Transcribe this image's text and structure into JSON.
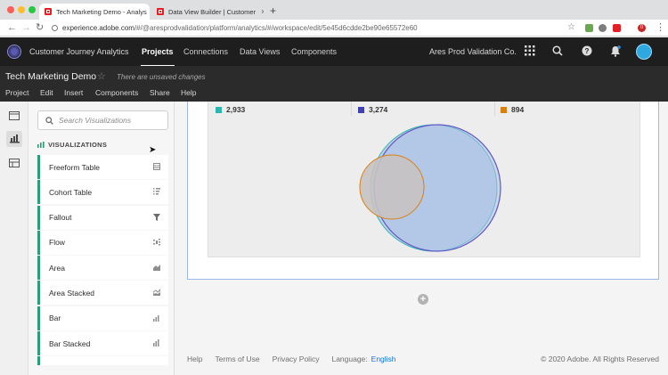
{
  "browser": {
    "tabs": [
      {
        "title": "Tech Marketing Demo - Analys",
        "active": true
      },
      {
        "title": "Data View Builder | Customer",
        "active": false
      }
    ],
    "url_host": "experience.adobe.com",
    "url_path": "/#/@aresprodvalidation/platform/analytics/#/workspace/edit/5e45d6cdde2be90e65572e60",
    "extension_badge": "0"
  },
  "app": {
    "name": "Customer Journey Analytics",
    "nav": [
      {
        "label": "Projects",
        "active": true
      },
      {
        "label": "Connections",
        "active": false
      },
      {
        "label": "Data Views",
        "active": false
      },
      {
        "label": "Components",
        "active": false
      }
    ],
    "org": "Ares Prod Validation Co."
  },
  "project": {
    "title": "Tech Marketing Demo",
    "unsaved": "There are unsaved changes",
    "menu": [
      "Project",
      "Edit",
      "Insert",
      "Components",
      "Share",
      "Help"
    ]
  },
  "visualizations": {
    "search_placeholder": "Search Visualizations",
    "section_title": "VISUALIZATIONS",
    "items": [
      "Freeform Table",
      "Cohort Table",
      "Fallout",
      "Flow",
      "Area",
      "Area Stacked",
      "Bar",
      "Bar Stacked"
    ]
  },
  "chart_data": {
    "type": "venn",
    "series": [
      {
        "name": "",
        "value": 2933,
        "label": "2,933",
        "color": "#2bb5b0"
      },
      {
        "name": "",
        "value": 3274,
        "label": "3,274",
        "color": "#4040b0"
      },
      {
        "name": "",
        "value": 894,
        "label": "894",
        "color": "#d98013"
      }
    ]
  },
  "footer": {
    "links": [
      "Help",
      "Terms of Use",
      "Privacy Policy"
    ],
    "language_label": "Language:",
    "language": "English",
    "copyright": "© 2020 Adobe. All Rights Reserved"
  }
}
